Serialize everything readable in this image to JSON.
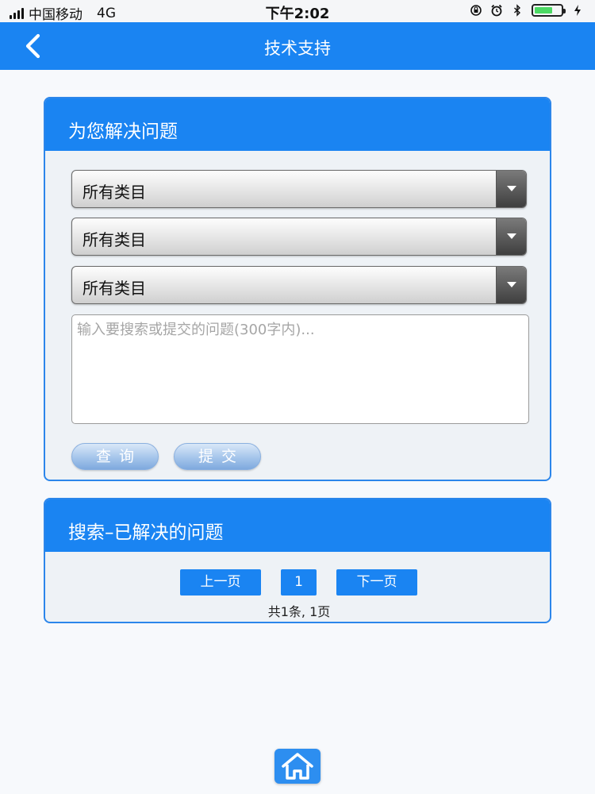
{
  "statusbar": {
    "carrier": "中国移动",
    "network": "4G",
    "time": "下午2:02"
  },
  "navbar": {
    "title": "技术支持"
  },
  "solve_card": {
    "title": "为您解决问题",
    "selects": [
      {
        "value": "所有类目"
      },
      {
        "value": "所有类目"
      },
      {
        "value": "所有类目"
      }
    ],
    "question_placeholder": "输入要搜索或提交的问题(300字内)...",
    "query_label": "查询",
    "submit_label": "提交"
  },
  "search_card": {
    "title": "搜索–已解决的问题",
    "prev_label": "上一页",
    "page_number": "1",
    "next_label": "下一页",
    "summary": "共1条, 1页"
  },
  "colors": {
    "brand_blue": "#1a84f2"
  },
  "icons": {
    "back": "chevron-left-icon",
    "home": "home-icon"
  }
}
